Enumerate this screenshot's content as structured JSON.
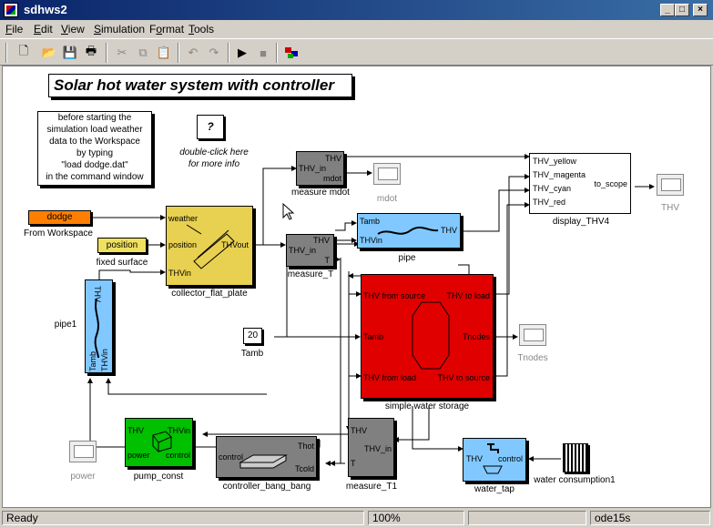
{
  "window": {
    "title": "sdhws2"
  },
  "menu": [
    {
      "label": "File",
      "u": "F",
      "rest": "ile"
    },
    {
      "label": "Edit",
      "u": "E",
      "rest": "dit"
    },
    {
      "label": "View",
      "u": "V",
      "rest": "iew"
    },
    {
      "label": "Simulation",
      "u": "S",
      "rest": "imulation"
    },
    {
      "label": "Format",
      "u": "o",
      "pre": "F",
      "rest": "rmat"
    },
    {
      "label": "Tools",
      "u": "T",
      "rest": "ools"
    }
  ],
  "toolbar": [
    "new-icon",
    "open-icon",
    "save-icon",
    "print-icon",
    "cut-icon",
    "copy-icon",
    "paste-icon",
    "undo-icon",
    "redo-icon",
    "start-simulation-icon",
    "stop-simulation-icon",
    "library-browser-icon"
  ],
  "diagram": {
    "title": "Solar hot water system with controller",
    "note": [
      "before starting the",
      "simulation load weather",
      "data to the Workspace",
      "by typing",
      "\"load dodge.dat\"",
      "in the command window"
    ],
    "info": {
      "symbol": "?",
      "text1": "double-click here",
      "text2": "for more info"
    },
    "blocks": {
      "from_workspace": {
        "value": "dodge",
        "label": "From Workspace"
      },
      "fixed_surface": {
        "value": "position",
        "label": "fixed surface"
      },
      "collector": {
        "label": "collector_flat_plate",
        "in1": "weather",
        "in2": "position",
        "in3": "THVin",
        "out": "THVout"
      },
      "pipe1": {
        "label": "pipe1",
        "p1": "THV",
        "p2": "Tamb",
        "p3": "THVin"
      },
      "measure_mdot": {
        "label": "measure mdot",
        "p1": "THV",
        "p2": "THV_in",
        "p3": "mdot"
      },
      "mdot_scope": {
        "label": "mdot"
      },
      "measure_T": {
        "label": "measure_T",
        "p1": "THV",
        "p2": "THV_in",
        "p3": "T"
      },
      "pipe": {
        "label": "pipe",
        "p1": "Tamb",
        "p2": "THVin",
        "p3": "THV"
      },
      "display": {
        "label": "display_THV4",
        "in1": "THV_yellow",
        "in2": "THV_magenta",
        "in3": "THV_cyan",
        "in4": "THV_red",
        "out": "to_scope"
      },
      "thv_scope": {
        "label": "THV"
      },
      "storage": {
        "label": "simple water storage",
        "p1": "THV from source",
        "p2": "THV to load",
        "p3": "Tamb",
        "p4": "Tnodes",
        "p5": "THV from load",
        "p6": "THV to source"
      },
      "tnodes_scope": {
        "label": "Tnodes"
      },
      "tamb": {
        "value": "20",
        "label": "Tamb"
      },
      "pump": {
        "label": "pump_const",
        "p1": "THV",
        "p2": "THVin",
        "p3": "power",
        "p4": "control"
      },
      "power_scope": {
        "label": "power"
      },
      "controller": {
        "label": "controller_bang_bang",
        "p1": "control",
        "p2": "Thot",
        "p3": "Tcold"
      },
      "measure_T1": {
        "label": "measure_T1",
        "p1": "THV",
        "p2": "THV_in",
        "p3": "T"
      },
      "water_tap": {
        "label": "water_tap",
        "p1": "THV",
        "p2": "control"
      },
      "water_consumption": {
        "label": "water consumption1"
      }
    }
  },
  "status": {
    "text": "Ready",
    "zoom": "100%",
    "solver": "ode15s"
  },
  "colors": {
    "orange": "#ff7f00",
    "yellow": "#e8d050",
    "light_yellow": "#f0e060",
    "blue": "#80c8ff",
    "red": "#e00000",
    "green": "#00c000",
    "gray": "#808080"
  }
}
